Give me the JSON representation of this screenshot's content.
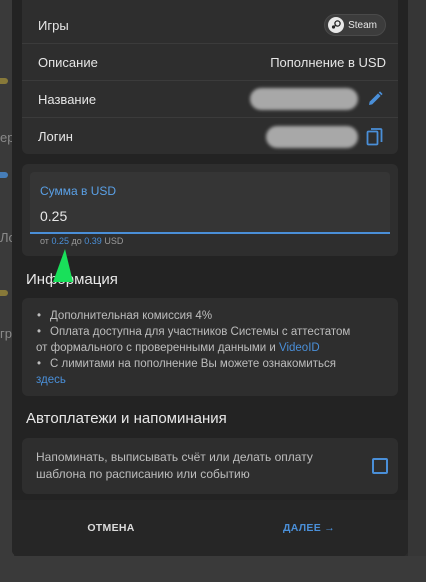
{
  "background": {
    "fragments": [
      "ер",
      "Ло",
      "гр"
    ]
  },
  "info": {
    "rows": [
      {
        "label": "Игры",
        "badge": "Steam"
      },
      {
        "label": "Описание",
        "value": "Пополнение в USD"
      },
      {
        "label": "Название"
      },
      {
        "label": "Логин"
      }
    ]
  },
  "amount": {
    "label": "Сумма в USD",
    "value": "0.25",
    "hint_from": "от",
    "min": "0.25",
    "hint_to": "до",
    "max": "0.39",
    "currency": "USD"
  },
  "information": {
    "title": "Информация",
    "items": [
      "Дополнительная комиссия 4%",
      "Оплата доступна для участников Системы с аттестатом",
      "С лимитами на пополнение Вы можете ознакомиться"
    ],
    "item2_cont": "от формального с проверенными данными и",
    "item2_link": "VideoID",
    "item3_link": "здесь"
  },
  "auto": {
    "title": "Автоплатежи и напоминания",
    "reminder_line1": "Напоминать, выписывать счёт или делать оплату",
    "reminder_line2": "шаблона по расписанию или событию"
  },
  "footer": {
    "cancel": "ОТМЕНА",
    "next": "ДАЛЕЕ",
    "next_arrow": "→"
  },
  "colors": {
    "accent": "#4a8fd8",
    "dialog": "#232323",
    "card": "#2e2e2e",
    "pointer": "#19e05a"
  }
}
